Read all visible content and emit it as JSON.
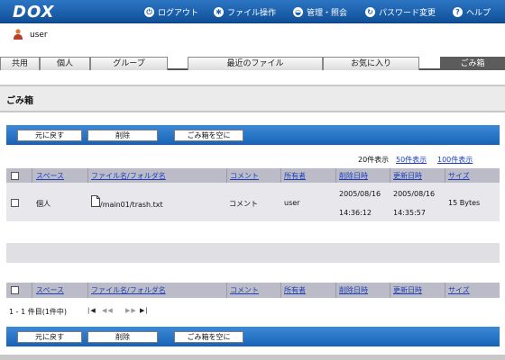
{
  "header": {
    "logo": "DOX",
    "nav": [
      {
        "label": "ログアウト",
        "icon": "logout-icon"
      },
      {
        "label": "ファイル操作",
        "icon": "file-ops-icon"
      },
      {
        "label": "管理・照会",
        "icon": "admin-icon"
      },
      {
        "label": "パスワード変更",
        "icon": "refresh-icon"
      },
      {
        "label": "ヘルプ",
        "icon": "help-icon"
      }
    ]
  },
  "user": {
    "name": "user"
  },
  "tabs": [
    "共用",
    "個人",
    "グループ",
    "最近のファイル",
    "お気に入り",
    "ごみ箱"
  ],
  "page_title": "ごみ箱",
  "actions": {
    "restore": "元に戻す",
    "delete": "削除",
    "empty": "ごみ箱を空に"
  },
  "display": {
    "current": "20件表示",
    "opt50": "50件表示",
    "opt100": "100件表示"
  },
  "columns": [
    "スペース",
    "ファイル名/フォルダ名",
    "コメント",
    "所有者",
    "削除日時",
    "更新日時",
    "サイズ"
  ],
  "rows": [
    {
      "space": "個人",
      "filename": "/main01/trash.txt",
      "comment": "コメント",
      "owner": "user",
      "deleted_date": "2005/08/16",
      "deleted_time": "14:36:12",
      "updated_date": "2005/08/16",
      "updated_time": "14:35:57",
      "size": "15 Bytes"
    }
  ],
  "pager": {
    "text": "1 - 1 件目(1件中)",
    "first": "|◀",
    "prev": "◀◀",
    "next": "▶▶",
    "last": "▶|"
  }
}
